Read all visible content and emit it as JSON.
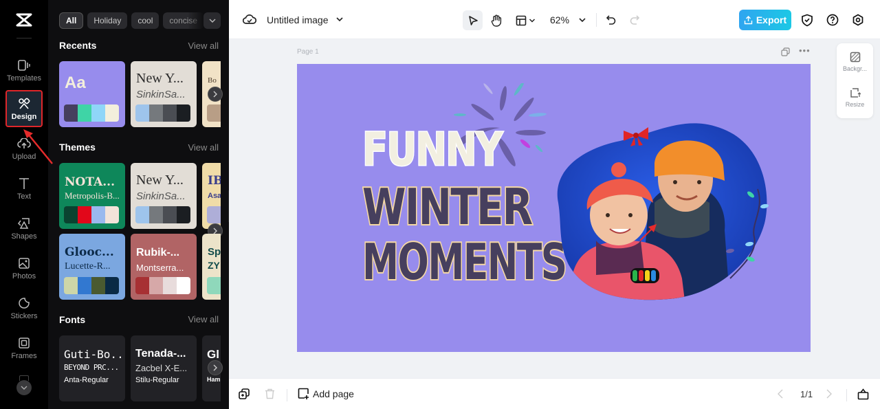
{
  "rail": {
    "items": [
      {
        "label": "Templates",
        "icon": "templates-icon"
      },
      {
        "label": "Design",
        "icon": "design-icon",
        "active": true
      },
      {
        "label": "Upload",
        "icon": "upload-icon"
      },
      {
        "label": "Text",
        "icon": "text-icon"
      },
      {
        "label": "Shapes",
        "icon": "shapes-icon"
      },
      {
        "label": "Photos",
        "icon": "photos-icon"
      },
      {
        "label": "Stickers",
        "icon": "stickers-icon"
      },
      {
        "label": "Frames",
        "icon": "frames-icon"
      }
    ]
  },
  "panel": {
    "chips": [
      "All",
      "Holiday",
      "cool",
      "concise"
    ],
    "recents": {
      "title": "Recents",
      "view_all": "View all",
      "cards": [
        {
          "line1": "Aa",
          "line2": "",
          "bg": "#978ced",
          "colors": [
            "#463f5e",
            "#3fd4a6",
            "#8fd6f8",
            "#f3efdc"
          ]
        },
        {
          "line1": "New Y...",
          "line2": "SinkinSa...",
          "bg": "#e2ddd6",
          "colors": [
            "#9ec4ec",
            "#75797d",
            "#4a4d53",
            "#1b1e22"
          ]
        },
        {
          "line1": "Bo",
          "line2": "",
          "bg": "#f1e2c6",
          "colors": [
            "#b89e86"
          ]
        }
      ]
    },
    "themes": {
      "title": "Themes",
      "view_all": "View all",
      "rows": [
        [
          {
            "line1": "NOTA...",
            "line2": "Metropolis-B...",
            "bg": "#0e875a",
            "fg1": "#f6e3d8",
            "fg2": "#f6e3d8",
            "colors": [
              "#0a4330",
              "#e2071a",
              "#9ab9ee",
              "#f3e3d9"
            ]
          },
          {
            "line1": "New Y...",
            "line2": "SinkinSa...",
            "bg": "#e2ddd6",
            "fg1": "#2b2b2b",
            "fg2": "#555",
            "colors": [
              "#9ec4ec",
              "#75797d",
              "#4a4d53",
              "#1b1e22"
            ]
          },
          {
            "line1": "IB",
            "line2": "Asa",
            "bg": "#f0dca8",
            "fg1": "#3a3e8c",
            "fg2": "#3a3e8c",
            "colors": [
              "#aeaed8"
            ]
          }
        ],
        [
          {
            "line1": "Glooc...",
            "line2": "Lucette-R...",
            "bg": "#7ba7e0",
            "fg1": "#0c2a48",
            "fg2": "#0c2a48",
            "colors": [
              "#cdd6a8",
              "#3278d0",
              "#4a5a30",
              "#0a2a45"
            ]
          },
          {
            "line1": "Rubik-...",
            "line2": "Montserra...",
            "bg": "#b16465",
            "fg1": "#ffffff",
            "fg2": "#ffffff",
            "colors": [
              "#a73033",
              "#d6a8a8",
              "#e8dcdc",
              "#ffffff"
            ]
          },
          {
            "line1": "Sp",
            "line2": "ZY",
            "bg": "#ece3c9",
            "fg1": "#124c4a",
            "fg2": "#124c4a",
            "colors": [
              "#8fd8bb"
            ]
          }
        ]
      ]
    },
    "fonts": {
      "title": "Fonts",
      "view_all": "View all",
      "cards": [
        {
          "line1": "Guti-Bo...",
          "line2": "BEYOND PRC...",
          "line3": "Anta-Regular"
        },
        {
          "line1": "Tenada-...",
          "line2": "Zacbel X-E...",
          "line3": "Stilu-Regular"
        },
        {
          "line1": "Gl",
          "line2": "",
          "line3": "Ham"
        }
      ]
    }
  },
  "topbar": {
    "doc_title": "Untitled image",
    "zoom": "62%",
    "export_label": "Export",
    "accent": "#1fb8ea"
  },
  "workspace": {
    "page_label": "Page 1",
    "side_tools": [
      {
        "label": "Backgr...",
        "icon": "background-icon"
      },
      {
        "label": "Resize",
        "icon": "resize-icon"
      }
    ],
    "artboard": {
      "bg": "#978ced",
      "headline": [
        "FUNNY",
        "WINTER",
        "MOMENTS"
      ]
    }
  },
  "bottombar": {
    "add_page": "Add page",
    "pager": "1/1"
  }
}
